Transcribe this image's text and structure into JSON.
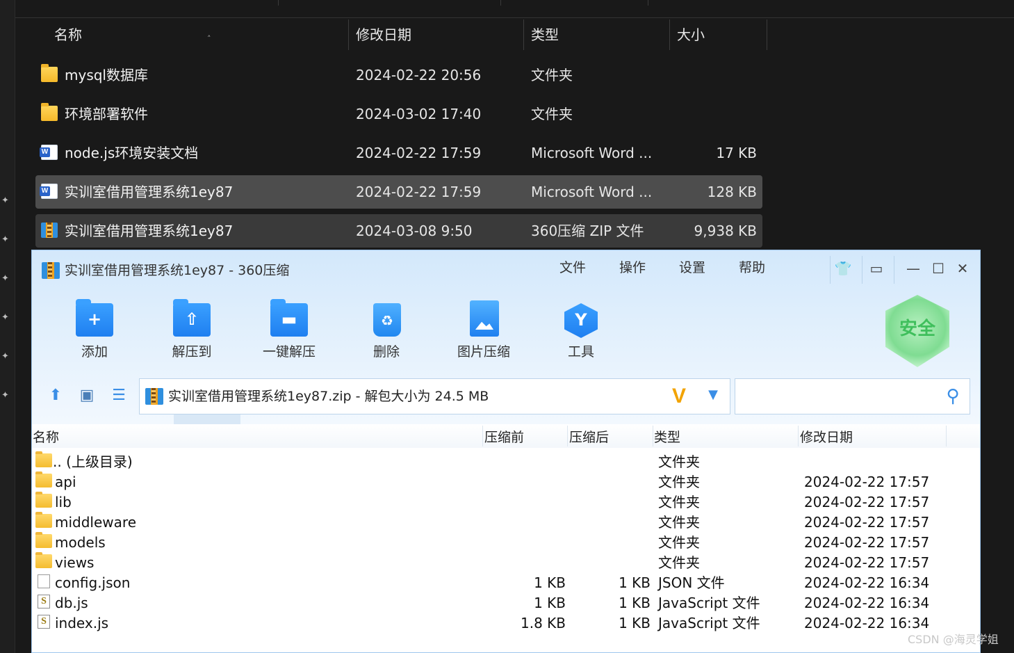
{
  "explorer": {
    "columns": {
      "name": "名称",
      "modified": "修改日期",
      "type": "类型",
      "size": "大小"
    },
    "rows": [
      {
        "name": "mysql数据库",
        "date": "2024-02-22 20:56",
        "type": "文件夹",
        "size": ""
      },
      {
        "name": "环境部署软件",
        "date": "2024-03-02 17:40",
        "type": "文件夹",
        "size": ""
      },
      {
        "name": "node.js环境安装文档",
        "date": "2024-02-22 17:59",
        "type": "Microsoft Word ...",
        "size": "17 KB"
      },
      {
        "name": "实训室借用管理系统1ey87",
        "date": "2024-02-22 17:59",
        "type": "Microsoft Word ...",
        "size": "128 KB"
      },
      {
        "name": "实训室借用管理系统1ey87",
        "date": "2024-03-08 9:50",
        "type": "360压缩 ZIP 文件",
        "size": "9,938 KB"
      }
    ]
  },
  "zip": {
    "title": "实训室借用管理系统1ey87 - 360压缩",
    "menu": [
      "文件",
      "操作",
      "设置",
      "帮助"
    ],
    "toolbar": [
      {
        "label": "添加",
        "icon": "add-icon"
      },
      {
        "label": "解压到",
        "icon": "extract-to-icon"
      },
      {
        "label": "一键解压",
        "icon": "one-click-extract-icon"
      },
      {
        "label": "删除",
        "icon": "delete-icon"
      },
      {
        "label": "图片压缩",
        "icon": "image-compress-icon"
      },
      {
        "label": "工具",
        "icon": "tools-icon"
      }
    ],
    "security_badge": "安全",
    "address": "实训室借用管理系统1ey87.zip - 解包大小为 24.5 MB",
    "search_placeholder": "",
    "columns": {
      "name": "名称",
      "before": "压缩前",
      "after": "压缩后",
      "type": "类型",
      "modified": "修改日期"
    },
    "rows": [
      {
        "name": ".. (上级目录)",
        "before": "",
        "after": "",
        "type": "文件夹",
        "date": "",
        "kind": "folder"
      },
      {
        "name": "api",
        "before": "",
        "after": "",
        "type": "文件夹",
        "date": "2024-02-22 17:57",
        "kind": "folder"
      },
      {
        "name": "lib",
        "before": "",
        "after": "",
        "type": "文件夹",
        "date": "2024-02-22 17:57",
        "kind": "folder"
      },
      {
        "name": "middleware",
        "before": "",
        "after": "",
        "type": "文件夹",
        "date": "2024-02-22 17:57",
        "kind": "folder"
      },
      {
        "name": "models",
        "before": "",
        "after": "",
        "type": "文件夹",
        "date": "2024-02-22 17:57",
        "kind": "folder"
      },
      {
        "name": "views",
        "before": "",
        "after": "",
        "type": "文件夹",
        "date": "2024-02-22 17:57",
        "kind": "folder"
      },
      {
        "name": "config.json",
        "before": "1 KB",
        "after": "1 KB",
        "type": "JSON 文件",
        "date": "2024-02-22 16:34",
        "kind": "file"
      },
      {
        "name": "db.js",
        "before": "1 KB",
        "after": "1 KB",
        "type": "JavaScript 文件",
        "date": "2024-02-22 16:34",
        "kind": "js"
      },
      {
        "name": "index.js",
        "before": "1.8 KB",
        "after": "1 KB",
        "type": "JavaScript 文件",
        "date": "2024-02-22 16:34",
        "kind": "js"
      }
    ]
  },
  "watermark": "CSDN @海灵学姐"
}
